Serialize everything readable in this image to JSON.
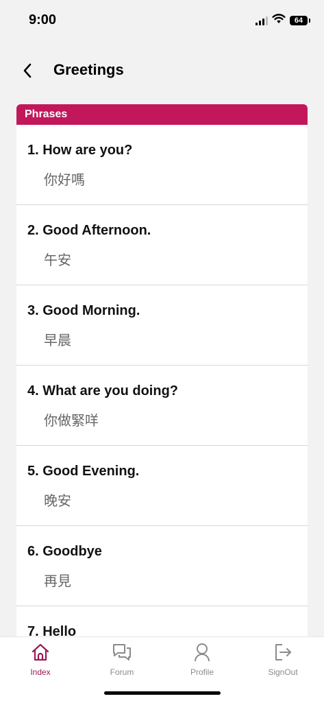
{
  "status_bar": {
    "time": "9:00",
    "battery": "64"
  },
  "header": {
    "title": "Greetings"
  },
  "card": {
    "header_label": "Phrases",
    "phrases": [
      {
        "english": "1. How are you?",
        "chinese": "你好嗎"
      },
      {
        "english": "2. Good Afternoon.",
        "chinese": "午安"
      },
      {
        "english": "3. Good Morning.",
        "chinese": "早晨"
      },
      {
        "english": "4. What are you doing?",
        "chinese": "你做緊咩"
      },
      {
        "english": "5. Good Evening.",
        "chinese": "晚安"
      },
      {
        "english": "6. Goodbye",
        "chinese": "再見"
      },
      {
        "english": "7. Hello",
        "chinese": ""
      }
    ]
  },
  "tab_bar": {
    "tabs": [
      {
        "label": "Index",
        "icon": "home-icon",
        "active": true
      },
      {
        "label": "Forum",
        "icon": "chat-icon",
        "active": false
      },
      {
        "label": "Profile",
        "icon": "person-icon",
        "active": false
      },
      {
        "label": "SignOut",
        "icon": "signout-icon",
        "active": false
      }
    ]
  },
  "colors": {
    "accent": "#c2185b",
    "active_tab": "#9c1a55",
    "inactive_tab": "#8a8a8a",
    "background": "#f2f2f2"
  }
}
